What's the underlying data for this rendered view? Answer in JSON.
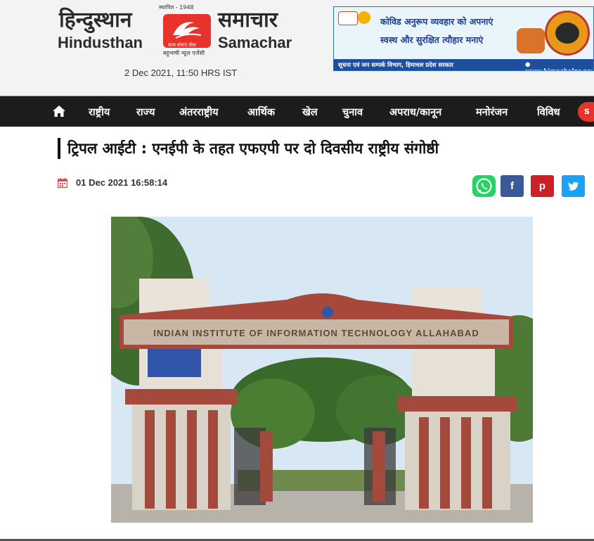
{
  "header": {
    "logo": {
      "hindi_left": "हिन्दुस्थान",
      "hindi_right": "समाचार",
      "english_left": "Hindusthan",
      "english_right": "Samachar",
      "established": "स्थापित - 1948",
      "tagline": "सत्य संवाद सेवा",
      "subtitle": "बहुभाषी न्यूज़ एजेंसी"
    },
    "datetime": "2 Dec 2021, 11:50 HRS IST"
  },
  "banner": {
    "line1": "कोविड अनुरूप व्यवहार को अपनाएं",
    "line2": "स्वस्थ और सुरक्षित त्यौहार मनाएं",
    "footer_left": "सूचना एवं जन सम्पर्क विभाग, हिमाचल प्रदेश सरकार",
    "footer_right": "● www.himachalpr.gov.in"
  },
  "nav": {
    "home_icon": "home-icon",
    "items": [
      "राष्ट्रीय",
      "राज्य",
      "अंतरराष्ट्रीय",
      "आर्थिक",
      "खेल",
      "चुनाव",
      "अपराध/कानून",
      "मनोरंजन",
      "विविध"
    ],
    "search_label": "s"
  },
  "article": {
    "title": "ट्रिपल आईटी : एनईपी के तहत एफएपी पर दो दिवसीय राष्ट्रीय संगोष्ठी",
    "published": "01 Dec 2021 16:58:14",
    "calendar_icon": "calendar-icon",
    "share": {
      "whatsapp": "whatsapp-icon",
      "facebook": "f",
      "pinterest": "p",
      "twitter": "twitter-icon"
    },
    "image_caption_text": "INDIAN INSTITUTE OF INFORMATION TECHNOLOGY ALLAHABAD"
  },
  "colors": {
    "brand_red": "#e8332c",
    "nav_bg": "#1c1c1c",
    "whatsapp": "#25d366",
    "facebook": "#3b5998",
    "pinterest": "#cb2027",
    "twitter": "#1da1f2"
  }
}
